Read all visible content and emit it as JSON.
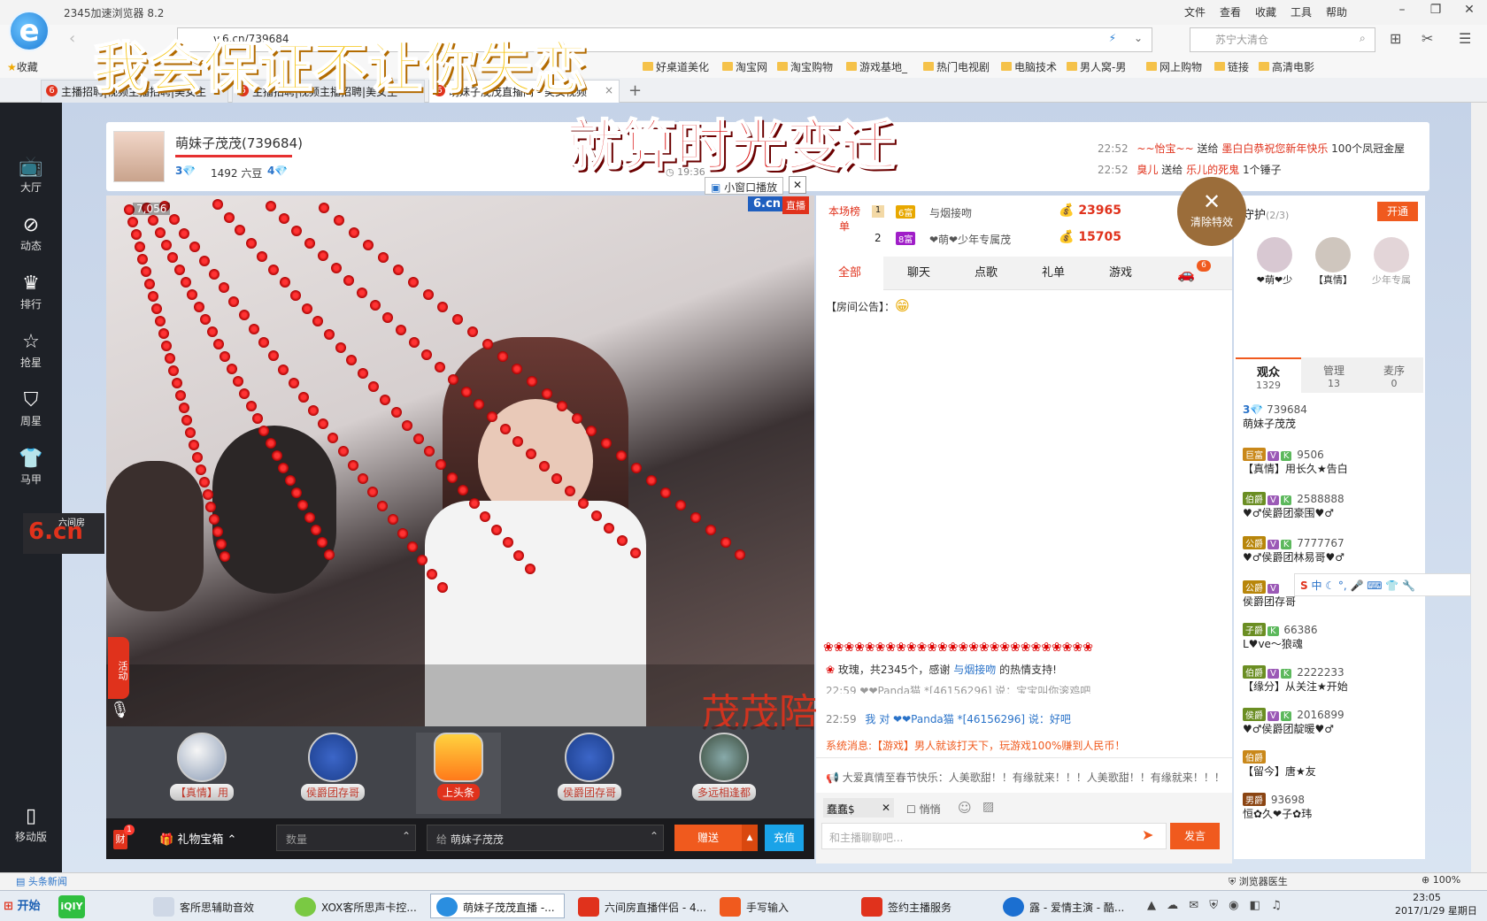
{
  "browser": {
    "title": "2345加速浏览器 8.2",
    "menu": [
      "文件",
      "查看",
      "收藏",
      "工具",
      "帮助"
    ],
    "url": "v.6.cn/739684",
    "search_placeholder": "苏宁大清仓",
    "favorites_label": "收藏",
    "favorites": [
      "好桌道美化",
      "淘宝网",
      "淘宝购物",
      "游戏基地_",
      "热门电视剧",
      "电脑技术",
      "男人窝-男",
      "网上购物",
      "链接",
      "高清电影"
    ],
    "tabs": [
      {
        "label": "主播招聘|视频主播招聘|美女主"
      },
      {
        "label": "主播招聘|视频主播招聘|美女主"
      },
      {
        "label": "萌妹子茂茂直播间 - 美女视频"
      }
    ]
  },
  "lyrics": {
    "line1": "我会保证不让你失恋",
    "line2": "就算时光变迁"
  },
  "leftnav": [
    {
      "icon": "tv-icon",
      "glyph": "📺",
      "label": "大厅"
    },
    {
      "icon": "compass-icon",
      "glyph": "⊘",
      "label": "动态"
    },
    {
      "icon": "crown-icon",
      "glyph": "♛",
      "label": "排行"
    },
    {
      "icon": "star-icon",
      "glyph": "☆",
      "label": "抢星"
    },
    {
      "icon": "bag-icon",
      "glyph": "⛉",
      "label": "周星"
    },
    {
      "icon": "shirt-icon",
      "glyph": "👕",
      "label": "马甲"
    }
  ],
  "leftnav_bottom": {
    "logo": "6.cn",
    "logo_sub": "六间房",
    "mobile": "移动版"
  },
  "room": {
    "host_name": "萌妹子茂茂(739684)",
    "level": "3",
    "beans": "1492 六豆",
    "level2": "4",
    "time": "19:36",
    "small_window": "小窗口播放",
    "viewer_count": "7,056",
    "live_badge": "直播",
    "logo": "6.cn",
    "activity_tab": "活动",
    "watermark": "茂茂陪"
  },
  "gift_feed": [
    {
      "time": "22:52",
      "user": "~~怡宝~~",
      "verb": "送给",
      "target": "墨白白恭祝您新年快乐",
      "gift": "100个凤冠金屋"
    },
    {
      "time": "22:52",
      "user": "臭儿",
      "verb": "送给",
      "target": "乐儿的死鬼",
      "gift": "1个锤子"
    }
  ],
  "clear_effects": "清除特效",
  "ranking": {
    "title": "本场榜单",
    "rows": [
      {
        "rank": "1",
        "name": "与烟接吻",
        "score": "23965"
      },
      {
        "rank": "2",
        "name": "❤萌❤少年专属茂",
        "score": "15705"
      }
    ]
  },
  "chat_tabs": [
    "全部",
    "聊天",
    "点歌",
    "礼单",
    "游戏"
  ],
  "chat_tab_badge": "6",
  "announcement": "【房间公告】：",
  "chat": {
    "gift_msg": "玫瑰，共2345个，感谢",
    "gift_msg_user": "与烟接吻",
    "gift_msg_tail": "的热情支持!",
    "line_partial": "22:59 ❤❤Panda猫 *[46156296] 说：宝宝叫你滚鸡吧",
    "line2_time": "22:59",
    "line2_text": "我 对 ❤❤Panda猫 *[46156296] 说：好吧",
    "system": "系统消息:【游戏】男人就该打天下，玩游戏100%赚到人民币！",
    "broadcast": "大爱真情至春节快乐：人美歌甜！！有缘就来！！！人美歌甜！！有缘就来！！！",
    "target": "蠢蠢$",
    "whisper": "悄悄",
    "input_placeholder": "和主播聊聊吧...",
    "send": "发言"
  },
  "guard": {
    "title": "守护",
    "count": "(2/3)",
    "open": "开通",
    "members": [
      "❤萌❤少",
      "【真情】",
      "少年专属"
    ]
  },
  "audience_tabs": [
    {
      "label": "观众",
      "count": "1329"
    },
    {
      "label": "管理",
      "count": "13"
    },
    {
      "label": "麦序",
      "count": "0"
    }
  ],
  "viewers": [
    {
      "id": "739684",
      "name": "萌妹子茂茂",
      "badge": "3"
    },
    {
      "id": "9506",
      "name": "【真情】用长久★告白",
      "badge": "巨富"
    },
    {
      "id": "2588888",
      "name": "♥♂侯爵团豪围♥♂",
      "badge": "伯爵"
    },
    {
      "id": "7777767",
      "name": "♥♂侯爵团林易哥♥♂",
      "badge": "公爵"
    },
    {
      "id": "",
      "name": "侯爵团存哥",
      "badge": "公爵"
    },
    {
      "id": "66386",
      "name": "L♥ve〜狼魂",
      "badge": "子爵"
    },
    {
      "id": "2222233",
      "name": "【缘分】从关注★开始",
      "badge": "伯爵"
    },
    {
      "id": "2016899",
      "name": "♥♂侯爵团靛暖♥♂",
      "badge": "侯爵"
    },
    {
      "id": "",
      "name": "【留今】唐★友",
      "badge": "伯爵"
    },
    {
      "id": "93698",
      "name": "恒✿久❤子✿玮",
      "badge": "男爵"
    }
  ],
  "gifts": [
    {
      "label": "【真情】用"
    },
    {
      "label": "侯爵团存哥"
    },
    {
      "label": "上头条"
    },
    {
      "label": "侯爵团存哥"
    },
    {
      "label": "多远相逢都"
    }
  ],
  "bottom": {
    "money_badge": "1",
    "giftbox": "礼物宝箱",
    "qty_placeholder": "数量",
    "to_label": "给",
    "to_name": "萌妹子茂茂",
    "give": "赠送",
    "recharge": "充值"
  },
  "ime": {
    "label": "中"
  },
  "statusbar": {
    "news": "头条新闻",
    "doctor": "浏览器医生",
    "zoom": "100%"
  },
  "taskbar": {
    "start": "开始",
    "items": [
      {
        "label": "客所思辅助音效"
      },
      {
        "label": "XOX客所思声卡控..."
      },
      {
        "label": "萌妹子茂茂直播 -..."
      },
      {
        "label": "六间房直播伴侣 - 4..."
      },
      {
        "label": "手写输入"
      },
      {
        "label": "签约主播服务"
      },
      {
        "label": "露 - 爱情主演 - 酷..."
      }
    ],
    "time": "23:05",
    "date": "2017/1/29 星期日"
  }
}
